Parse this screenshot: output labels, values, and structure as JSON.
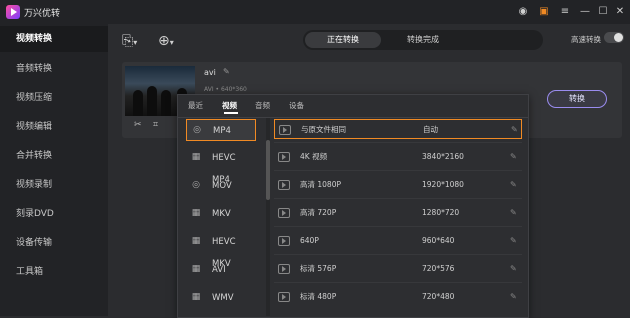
{
  "app": {
    "title": "万兴优转"
  },
  "sidebar": {
    "items": [
      {
        "label": "视频转换"
      },
      {
        "label": "音频转换"
      },
      {
        "label": "视频压缩"
      },
      {
        "label": "视频编辑"
      },
      {
        "label": "合并转换"
      },
      {
        "label": "视频录制"
      },
      {
        "label": "刻录DVD"
      },
      {
        "label": "设备传输"
      },
      {
        "label": "工具箱"
      }
    ]
  },
  "header": {
    "tabs": [
      {
        "label": "正在转换"
      },
      {
        "label": "转换完成"
      }
    ],
    "hs_label": "高速转换"
  },
  "file": {
    "name": "avi",
    "meta": "AVI  •  640*360",
    "convert_label": "转换"
  },
  "popup": {
    "tabs": [
      {
        "label": "最近"
      },
      {
        "label": "视频"
      },
      {
        "label": "音频"
      },
      {
        "label": "设备"
      }
    ],
    "formats": [
      {
        "label": "MP4"
      },
      {
        "label": "HEVC MP4"
      },
      {
        "label": "MOV"
      },
      {
        "label": "MKV"
      },
      {
        "label": "HEVC MKV"
      },
      {
        "label": "AVI"
      },
      {
        "label": "WMV"
      }
    ],
    "resolutions": [
      {
        "name": "与原文件相同",
        "value": "自动"
      },
      {
        "name": "4K 视频",
        "value": "3840*2160"
      },
      {
        "name": "高清 1080P",
        "value": "1920*1080"
      },
      {
        "name": "高清 720P",
        "value": "1280*720"
      },
      {
        "name": "640P",
        "value": "960*640"
      },
      {
        "name": "标清 576P",
        "value": "720*576"
      },
      {
        "name": "标清 480P",
        "value": "720*480"
      }
    ]
  }
}
